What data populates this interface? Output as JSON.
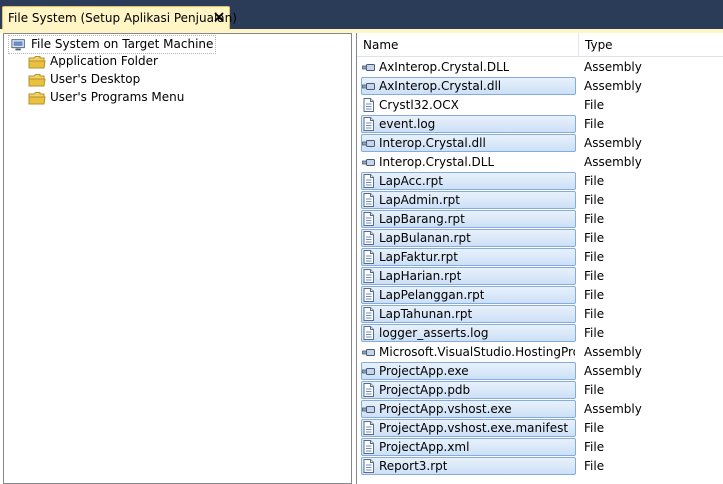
{
  "tab": {
    "title": "File System (Setup Aplikasi Penjualan)",
    "close_icon": "close-icon"
  },
  "tree": {
    "root": {
      "label": "File System on Target Machine",
      "icon": "computer-icon"
    },
    "children": [
      {
        "label": "Application Folder",
        "icon": "folder-icon"
      },
      {
        "label": "User's Desktop",
        "icon": "folder-icon"
      },
      {
        "label": "User's Programs Menu",
        "icon": "folder-icon"
      }
    ]
  },
  "list": {
    "columns": {
      "name": "Name",
      "type": "Type"
    },
    "rows": [
      {
        "name": "AxInterop.Crystal.DLL",
        "type": "Assembly",
        "icon": "assembly-icon",
        "selected": false
      },
      {
        "name": "AxInterop.Crystal.dll",
        "type": "Assembly",
        "icon": "assembly-icon",
        "selected": true
      },
      {
        "name": "Crystl32.OCX",
        "type": "File",
        "icon": "file-icon",
        "selected": false
      },
      {
        "name": "event.log",
        "type": "File",
        "icon": "file-icon",
        "selected": true
      },
      {
        "name": "Interop.Crystal.dll",
        "type": "Assembly",
        "icon": "assembly-icon",
        "selected": true
      },
      {
        "name": "Interop.Crystal.DLL",
        "type": "Assembly",
        "icon": "assembly-icon",
        "selected": false
      },
      {
        "name": "LapAcc.rpt",
        "type": "File",
        "icon": "file-icon",
        "selected": true
      },
      {
        "name": "LapAdmin.rpt",
        "type": "File",
        "icon": "file-icon",
        "selected": true
      },
      {
        "name": "LapBarang.rpt",
        "type": "File",
        "icon": "file-icon",
        "selected": true
      },
      {
        "name": "LapBulanan.rpt",
        "type": "File",
        "icon": "file-icon",
        "selected": true
      },
      {
        "name": "LapFaktur.rpt",
        "type": "File",
        "icon": "file-icon",
        "selected": true
      },
      {
        "name": "LapHarian.rpt",
        "type": "File",
        "icon": "file-icon",
        "selected": true
      },
      {
        "name": "LapPelanggan.rpt",
        "type": "File",
        "icon": "file-icon",
        "selected": true
      },
      {
        "name": "LapTahunan.rpt",
        "type": "File",
        "icon": "file-icon",
        "selected": true
      },
      {
        "name": "logger_asserts.log",
        "type": "File",
        "icon": "file-icon",
        "selected": true
      },
      {
        "name": "Microsoft.VisualStudio.HostingPro...",
        "type": "Assembly",
        "icon": "assembly-icon",
        "selected": false
      },
      {
        "name": "ProjectApp.exe",
        "type": "Assembly",
        "icon": "assembly-icon",
        "selected": true
      },
      {
        "name": "ProjectApp.pdb",
        "type": "File",
        "icon": "file-icon",
        "selected": true
      },
      {
        "name": "ProjectApp.vshost.exe",
        "type": "Assembly",
        "icon": "assembly-icon",
        "selected": true
      },
      {
        "name": "ProjectApp.vshost.exe.manifest",
        "type": "File",
        "icon": "file-icon",
        "selected": true
      },
      {
        "name": "ProjectApp.xml",
        "type": "File",
        "icon": "file-icon",
        "selected": true
      },
      {
        "name": "Report3.rpt",
        "type": "File",
        "icon": "file-icon",
        "selected": true
      }
    ]
  },
  "colors": {
    "background": "#2b3c59",
    "tab": "#fff5c5",
    "tab_border": "#e5c365",
    "selection_top": "#e8f1fb",
    "selection_bottom": "#cde0f7",
    "selection_border": "#84acdd",
    "folder": "#e8c23e"
  }
}
